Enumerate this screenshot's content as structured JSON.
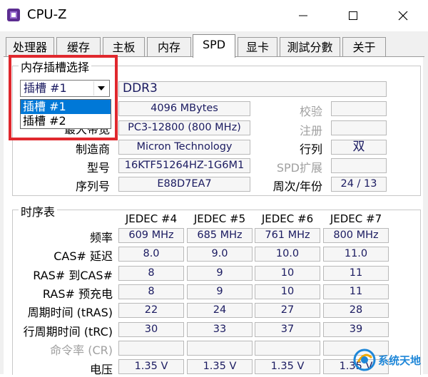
{
  "window": {
    "title": "CPU-Z",
    "accent": "#0078d7",
    "highlight_box_color": "#e0282e"
  },
  "tabs": [
    {
      "label": "处理器"
    },
    {
      "label": "缓存"
    },
    {
      "label": "主板"
    },
    {
      "label": "内存"
    },
    {
      "label": "SPD",
      "active": true
    },
    {
      "label": "显卡"
    },
    {
      "label": "測試分數"
    },
    {
      "label": "关于"
    }
  ],
  "slot_group": {
    "title": "内存插槽选择",
    "combo_value": "插槽 #1",
    "dropdown_options": [
      "插槽 #1",
      "插槽 #2"
    ],
    "selected_index": 0,
    "type_value": "DDR3"
  },
  "module": {
    "size_value": "4096 MBytes",
    "max_bandwidth_label": "最大带宽",
    "max_bandwidth_value": "PC3-12800 (800 MHz)",
    "manufacturer_label": "制造商",
    "manufacturer_value": "Micron Technology",
    "part_label": "型号",
    "part_value": "16KTF51264HZ-1G6M1",
    "serial_label": "序列号",
    "serial_value": "E88D7EA7",
    "ecc_label": "校验",
    "registered_label": "注册",
    "ranks_label": "行列",
    "ranks_value": "双",
    "spd_ext_label": "SPD扩展",
    "week_year_label": "周次/年份",
    "week_year_value": "24 / 13"
  },
  "timing": {
    "title": "时序表",
    "columns": [
      "JEDEC #4",
      "JEDEC #5",
      "JEDEC #6",
      "JEDEC #7"
    ],
    "rows": [
      {
        "label": "频率",
        "values": [
          "609 MHz",
          "685 MHz",
          "761 MHz",
          "800 MHz"
        ]
      },
      {
        "label": "CAS# 延迟",
        "values": [
          "8.0",
          "9.0",
          "10.0",
          "11.0"
        ]
      },
      {
        "label": "RAS# 到CAS#",
        "values": [
          "8",
          "9",
          "10",
          "11"
        ]
      },
      {
        "label": "RAS# 预充电",
        "values": [
          "8",
          "9",
          "10",
          "11"
        ]
      },
      {
        "label": "周期时间 (tRAS)",
        "values": [
          "22",
          "24",
          "27",
          "28"
        ]
      },
      {
        "label": "行周期时间 (tRC)",
        "values": [
          "30",
          "33",
          "37",
          "39"
        ]
      },
      {
        "label": "命令率 (CR)",
        "values": [
          "",
          "",
          "",
          ""
        ],
        "disabled": true
      },
      {
        "label": "电压",
        "values": [
          "1.35 V",
          "1.35 V",
          "1.35 V",
          "1.35 V"
        ]
      }
    ]
  },
  "watermark": {
    "text": "系统天地"
  }
}
